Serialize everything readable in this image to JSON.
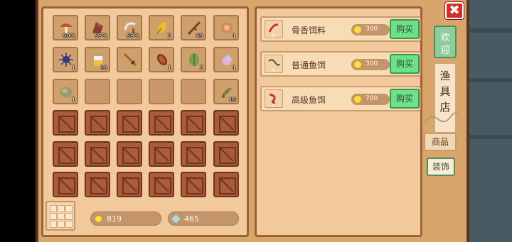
{
  "shop": {
    "sign_top": [
      "欢",
      "迎"
    ],
    "sign_body": [
      "渔",
      "具",
      "店"
    ],
    "tabs": {
      "goods": "商品",
      "decor": "装饰"
    },
    "close_glyph": "✖",
    "items": [
      {
        "name": "骨香饵料",
        "price": "300",
        "buy_label": "购买",
        "badge": "5",
        "icon": "bone-bait-icon"
      },
      {
        "name": "普通鱼饵",
        "price": "300",
        "buy_label": "购买",
        "badge": "5",
        "icon": "worm-bait-icon"
      },
      {
        "name": "高级鱼饵",
        "price": "700",
        "buy_label": "购买",
        "badge": "5",
        "icon": "premium-bait-icon"
      }
    ]
  },
  "inventory": {
    "items": [
      {
        "icon": "mushroom-icon",
        "count": "90%"
      },
      {
        "icon": "wood-chunk-icon",
        "count": "57%"
      },
      {
        "icon": "sickle-icon",
        "count": "59%"
      },
      {
        "icon": "corn-icon",
        "count": "2"
      },
      {
        "icon": "stick-icon",
        "count": "69"
      },
      {
        "icon": "shell-icon",
        "count": "1"
      },
      {
        "icon": "sea-urchin-icon",
        "count": "1"
      },
      {
        "icon": "jar-icon",
        "count": "18"
      },
      {
        "icon": "sword-icon",
        "count": ""
      },
      {
        "icon": "pinecone-icon",
        "count": "1"
      },
      {
        "icon": "leaf-icon",
        "count": "2"
      },
      {
        "icon": "crystal-icon",
        "count": "1"
      },
      {
        "icon": "stone-icon",
        "count": "1"
      },
      {
        "icon": "fish-icon",
        "count": "10"
      }
    ],
    "gold": "819",
    "gems": "465"
  },
  "colors": {
    "buy": "#6fe08a",
    "coin": "#ffd94a",
    "gem": "#a6d8ee",
    "close": "#d0302a"
  }
}
